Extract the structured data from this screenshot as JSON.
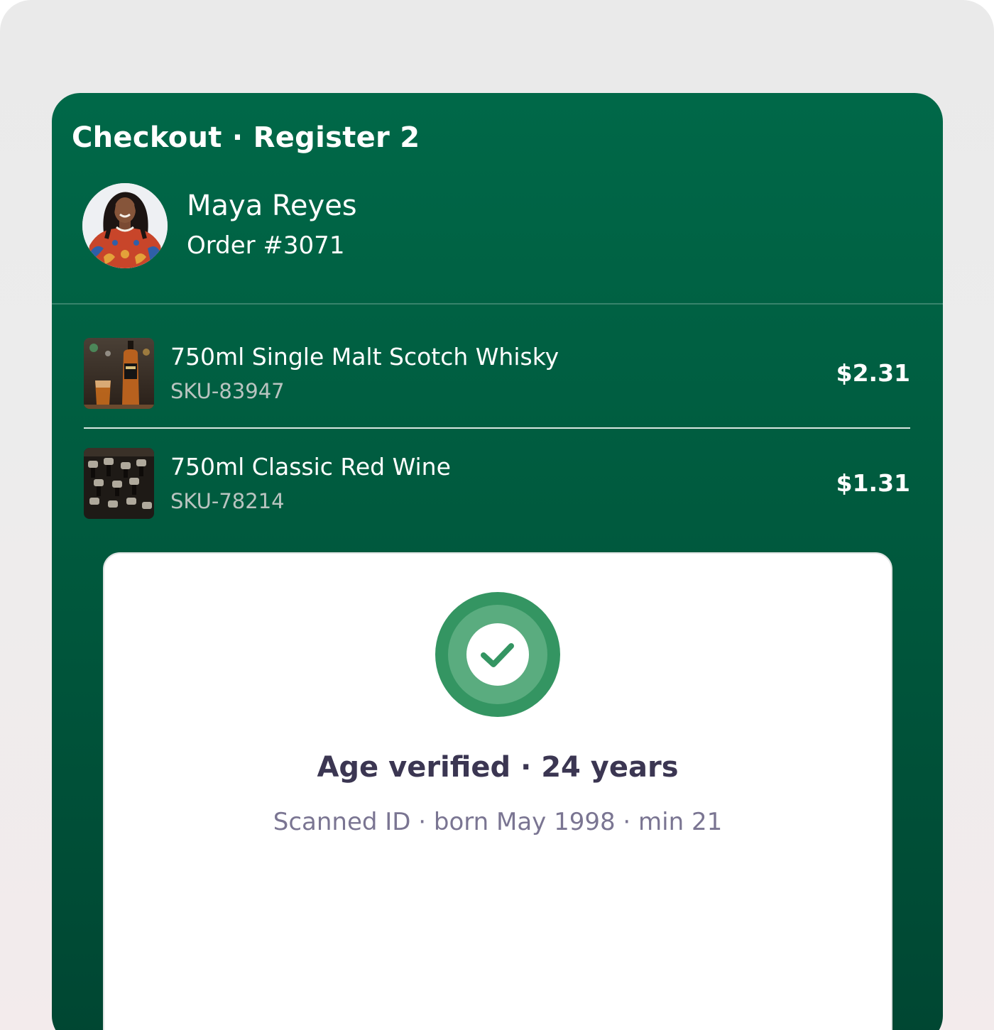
{
  "header": {
    "title": "Checkout · Register 2"
  },
  "customer": {
    "name": "Maya Reyes",
    "order": "Order #3071",
    "avatar_icon": "customer-photo"
  },
  "items": [
    {
      "name": "750ml Single Malt Scotch Whisky",
      "sku": "SKU-83947",
      "price": "$2.31",
      "thumbnail_icon": "whisky-bottle-photo"
    },
    {
      "name": "750ml Classic Red Wine",
      "sku": "SKU-78214",
      "price": "$1.31",
      "thumbnail_icon": "wine-bottles-photo"
    }
  ],
  "verification": {
    "title": "Age verified · 24 years",
    "detail": "Scanned ID · born May 1998 · min 21",
    "icon": "check-circle-icon"
  },
  "colors": {
    "card_top": "#006848",
    "card_bottom": "#004632",
    "accent_green": "#349562",
    "title_text": "#3b3652",
    "detail_text": "#7a7592",
    "sku_text": "#b9c4c0"
  }
}
